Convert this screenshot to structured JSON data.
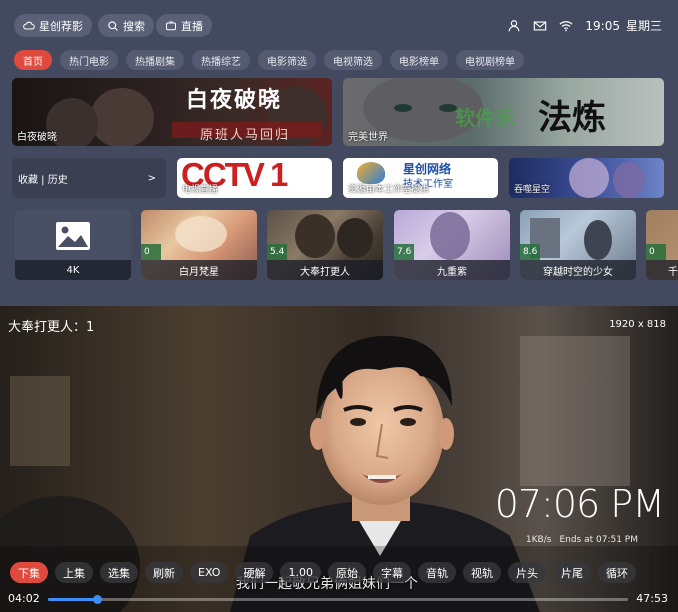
{
  "topbar": {
    "home_label": "星创荐影",
    "search_label": "搜索",
    "live_label": "直播",
    "time": "19:05",
    "weekday": "星期三"
  },
  "categories": [
    "首页",
    "热门电影",
    "热播剧集",
    "热播综艺",
    "电影筛选",
    "电视筛选",
    "电影榜单",
    "电视剧榜单"
  ],
  "banners": [
    {
      "title": "白夜破晓",
      "poster_text": "白夜破晓",
      "poster_subtext": "原班人马回归"
    },
    {
      "title": "完美世界",
      "poster_text": "法炼",
      "poster_watermark": "软件乐"
    }
  ],
  "shortcuts": {
    "favorites_label": "收藏 | 历史",
    "favorites_arrow": ">",
    "live_tv_caption": "电视直播",
    "live_tv_logo": "CCTV 1",
    "studio_caption": "资源由本工作室提供",
    "studio_name": "星创网络",
    "studio_sub": "技术工作室",
    "anime_caption": "吞噬星空"
  },
  "cards": [
    {
      "title": "4K",
      "score": ""
    },
    {
      "title": "白月梵星",
      "score": "0"
    },
    {
      "title": "大奉打更人",
      "score": "5.4"
    },
    {
      "title": "九重紫",
      "score": "7.6"
    },
    {
      "title": "穿越时空的少女",
      "score": "8.6"
    },
    {
      "title": "千",
      "score": "0"
    }
  ],
  "player": {
    "title": "大奉打更人：1",
    "resolution": "1920 x 818",
    "clock": "07:06 PM",
    "speed": "1KB/s",
    "ends_at": "Ends at 07:51 PM",
    "subtitle": "我们一起敬兄弟俩姐妹们一个",
    "current_time": "04:02",
    "duration": "47:53",
    "progress_fraction": 0.084,
    "controls": [
      "下集",
      "上集",
      "选集",
      "刷新",
      "EXO",
      "硬解",
      "1.00",
      "原始",
      "字幕",
      "音轨",
      "视轨",
      "片头",
      "片尾",
      "循环"
    ]
  },
  "colors": {
    "accent": "#e04a3e",
    "progress": "#3e8ef7"
  }
}
